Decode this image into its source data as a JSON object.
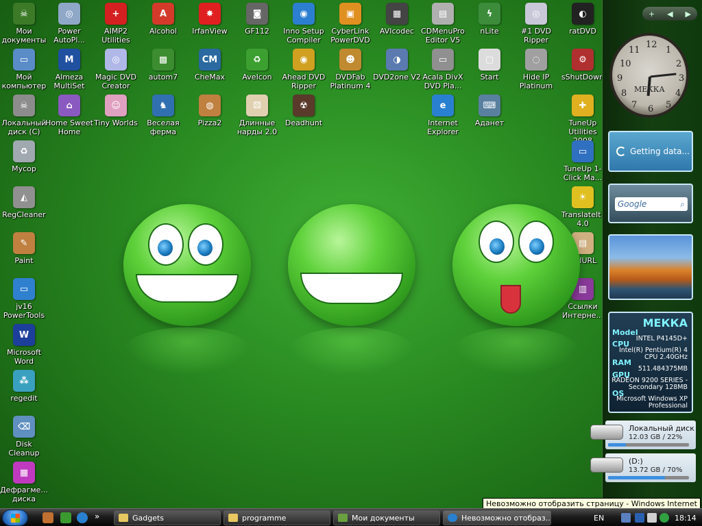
{
  "desktop": {
    "icons": [
      {
        "label": "Мои документы",
        "glyph": "☠",
        "color": "#3c7a28"
      },
      {
        "label": "Power AutoPl...",
        "glyph": "◎",
        "color": "#8fa8c8"
      },
      {
        "label": "AIMP2 Utilities",
        "glyph": "+",
        "color": "#d42020"
      },
      {
        "label": "Alcohol",
        "glyph": "A",
        "color": "#d33a2a"
      },
      {
        "label": "IrfanView",
        "glyph": "✸",
        "color": "#e02020"
      },
      {
        "label": "GF112",
        "glyph": "◙",
        "color": "#666666"
      },
      {
        "label": "Inno Setup Compiler",
        "glyph": "◉",
        "color": "#2c7fd0"
      },
      {
        "label": "CyberLink PowerDVD",
        "glyph": "▣",
        "color": "#e09020"
      },
      {
        "label": "AVIcodec",
        "glyph": "▦",
        "color": "#444444"
      },
      {
        "label": "CDMenuPro Editor V5",
        "glyph": "▤",
        "color": "#b0b0b0"
      },
      {
        "label": "nLite",
        "glyph": "ϟ",
        "color": "#3c8c3c"
      },
      {
        "label": "#1 DVD Ripper",
        "glyph": "◎",
        "color": "#c8c8d8"
      },
      {
        "label": "ratDVD",
        "glyph": "◐",
        "color": "#222222"
      },
      {
        "label": "Мой компьютер",
        "glyph": "▭",
        "color": "#5a8cc8"
      },
      {
        "label": "Almeza MultiSet",
        "glyph": "M",
        "color": "#2050a0"
      },
      {
        "label": "Magic DVD Creator",
        "glyph": "◎",
        "color": "#b0b8e8"
      },
      {
        "label": "autom7",
        "glyph": "▩",
        "color": "#3c8c30"
      },
      {
        "label": "CheMax",
        "glyph": "CM",
        "color": "#2a6aa0"
      },
      {
        "label": "AveIcon",
        "glyph": "♻",
        "color": "#3ca030"
      },
      {
        "label": "Ahead DVD Ripper",
        "glyph": "◉",
        "color": "#d0a020"
      },
      {
        "label": "DVDFab Platinum 4",
        "glyph": "☻",
        "color": "#c08a30"
      },
      {
        "label": "DVD2one V2",
        "glyph": "◑",
        "color": "#5a7ab0"
      },
      {
        "label": "Acala DivX DVD Pla...",
        "glyph": "▭",
        "color": "#909090"
      },
      {
        "label": "Start",
        "glyph": "▢",
        "color": "#dcdcdc"
      },
      {
        "label": "Hide IP Platinum",
        "glyph": "◌",
        "color": "#a0a0a0"
      },
      {
        "label": "sShutDown",
        "glyph": "⚙",
        "color": "#b03030"
      },
      {
        "label": "Локальный диск (C)",
        "glyph": "☠",
        "color": "#8c8c8c"
      },
      {
        "label": "Home Sweet Home",
        "glyph": "⌂",
        "color": "#8a5ac0"
      },
      {
        "label": "Tiny Worlds",
        "glyph": "☺",
        "color": "#e0a0c0"
      },
      {
        "label": "Веселая ферма",
        "glyph": "♞",
        "color": "#3070b0"
      },
      {
        "label": "Pizza2",
        "glyph": "◍",
        "color": "#c08040"
      },
      {
        "label": "Длинные нарды 2.0",
        "glyph": "⚄",
        "color": "#e0d0b0"
      },
      {
        "label": "Deadhunt",
        "glyph": "☢",
        "color": "#5a3a2a"
      },
      {
        "label": "Internet Explorer",
        "glyph": "e",
        "color": "#2a80d0"
      },
      {
        "label": "Аданет",
        "glyph": "⌨",
        "color": "#5a80a0"
      },
      {
        "label": "TuneUp Utilities 2008",
        "glyph": "✚",
        "color": "#e0b020"
      },
      {
        "label": "Мусор",
        "glyph": "♻",
        "color": "#a0a8b0"
      },
      {
        "label": "TuneUp 1-Click Ma...",
        "glyph": "▭",
        "color": "#3070c0"
      },
      {
        "label": "RegCleaner",
        "glyph": "◭",
        "color": "#909090"
      },
      {
        "label": "TranslateIt! 4.0",
        "glyph": "☀",
        "color": "#e0c020"
      },
      {
        "label": "Paint",
        "glyph": "✎",
        "color": "#c08040"
      },
      {
        "label": "FullURL",
        "glyph": "▤",
        "color": "#d0b080"
      },
      {
        "label": "jv16 PowerTools",
        "glyph": "▭",
        "color": "#3080d0"
      },
      {
        "label": "Ссылки Интерне...",
        "glyph": "▥",
        "color": "#8a3a9a"
      },
      {
        "label": "Microsoft Word",
        "glyph": "W",
        "color": "#1c3f9c"
      },
      {
        "label": "regedit",
        "glyph": "⁂",
        "color": "#3aa0c0"
      },
      {
        "label": "Disk Cleanup",
        "glyph": "⌫",
        "color": "#6090c0"
      },
      {
        "label": "Дефрагме... диска",
        "glyph": "▦",
        "color": "#c03ac0"
      }
    ]
  },
  "sidebar": {
    "top_buttons": [
      "+",
      "◀",
      "▶"
    ],
    "clock": {
      "label": "МЕККА",
      "numbers": [
        "12",
        "1",
        "2",
        "3",
        "4",
        "5",
        "6",
        "7",
        "8",
        "9",
        "10",
        "11"
      ]
    },
    "weather": {
      "text": "Getting data..."
    },
    "search": {
      "placeholder": "Google"
    },
    "sysinfo": {
      "computer": "МЕККА",
      "model_label": "Model",
      "cpu_label": "CPU",
      "model_value": "INTEL P4145D+",
      "cpu_value_1": "Intel(R) Pentium(R) 4",
      "cpu_value_2": "CPU 2.40GHz",
      "ram_label": "RAM",
      "ram_value": "511.484375MB",
      "gpu_label": "GPU",
      "gpu_value_1": "RADEON 9200 SERIES -",
      "gpu_value_2": "Secondary 128MB",
      "os_label": "OS",
      "os_value_1": "Microsoft Windows XP",
      "os_value_2": "Professional"
    },
    "drives": [
      {
        "name": "Локальный диск (C",
        "stat": "12.03 GB / 22%",
        "percent": 22
      },
      {
        "name": "(D:)",
        "stat": "13.72 GB / 70%",
        "percent": 70
      }
    ]
  },
  "tooltip": "Невозможно отобразить страницу - Windows Internet Explorer",
  "taskbar": {
    "quick_launch_glyph": "»",
    "tasks": [
      {
        "label": "Gadgets"
      },
      {
        "label": "programme"
      },
      {
        "label": "Мои документы"
      },
      {
        "label": "Невозможно отобраз..."
      }
    ],
    "language": "EN",
    "time": "18:14"
  }
}
